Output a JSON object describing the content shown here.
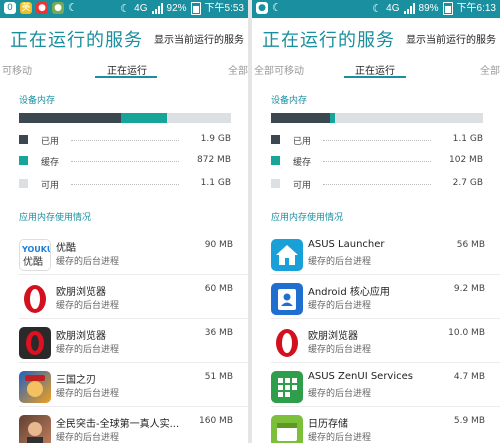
{
  "colors": {
    "accent": "#1a8fa0",
    "used": "#3c4850",
    "cache": "#16a598",
    "free": "#dde0e2"
  },
  "left": {
    "status": {
      "icons": [
        "0",
        "美"
      ],
      "net": "4G",
      "battery": "92%",
      "time": "下午5:53"
    },
    "header": {
      "title": "正在运行的服务",
      "action": "显示当前运行的服务"
    },
    "tabs": {
      "prev": "可移动",
      "active": "正在运行",
      "next": "全部"
    },
    "device_section": "设备内存",
    "memory_fractions": {
      "used": 0.48,
      "cache": 0.22,
      "free": 0.3
    },
    "legend": [
      {
        "label": "已用",
        "value": "1.9 GB"
      },
      {
        "label": "缓存",
        "value": "872 MB"
      },
      {
        "label": "可用",
        "value": "1.1 GB"
      }
    ],
    "apps_section": "应用内存使用情况",
    "apps": [
      {
        "name": "优酷",
        "sub": "缓存的后台进程",
        "size": "90 MB",
        "icon": "youku-icon"
      },
      {
        "name": "欧朋浏览器",
        "sub": "缓存的后台进程",
        "size": "60 MB",
        "icon": "opera-icon"
      },
      {
        "name": "欧朋浏览器",
        "sub": "缓存的后台进程",
        "size": "36 MB",
        "icon": "opera-dark-icon"
      },
      {
        "name": "三国之刃",
        "sub": "缓存的后台进程",
        "size": "51 MB",
        "icon": "game-icon"
      },
      {
        "name": "全民突击-全球第一真人实...",
        "sub": "缓存的后台进程",
        "size": "160 MB",
        "icon": "shooter-game-icon"
      }
    ]
  },
  "right": {
    "status": {
      "net": "4G",
      "battery": "89%",
      "time": "下午6:13"
    },
    "header": {
      "title": "正在运行的服务",
      "action": "显示当前运行的服务"
    },
    "tabs": {
      "prev": "全部可移动",
      "active": "正在运行",
      "next": "全部"
    },
    "device_section": "设备内存",
    "memory_fractions": {
      "used": 0.28,
      "cache": 0.02,
      "free": 0.7
    },
    "legend": [
      {
        "label": "已用",
        "value": "1.1 GB"
      },
      {
        "label": "缓存",
        "value": "102 MB"
      },
      {
        "label": "可用",
        "value": "2.7 GB"
      }
    ],
    "apps_section": "应用内存使用情况",
    "apps": [
      {
        "name": "ASUS Launcher",
        "sub": "缓存的后台进程",
        "size": "56 MB",
        "icon": "home-icon"
      },
      {
        "name": "Android 核心应用",
        "sub": "缓存的后台进程",
        "size": "9.2 MB",
        "icon": "contacts-icon"
      },
      {
        "name": "欧朋浏览器",
        "sub": "缓存的后台进程",
        "size": "10.0 MB",
        "icon": "opera-icon"
      },
      {
        "name": "ASUS ZenUI Services",
        "sub": "缓存的后台进程",
        "size": "4.7 MB",
        "icon": "zenui-icon"
      },
      {
        "name": "日历存储",
        "sub": "缓存的后台进程",
        "size": "5.9 MB",
        "icon": "calendar-storage-icon"
      }
    ]
  }
}
